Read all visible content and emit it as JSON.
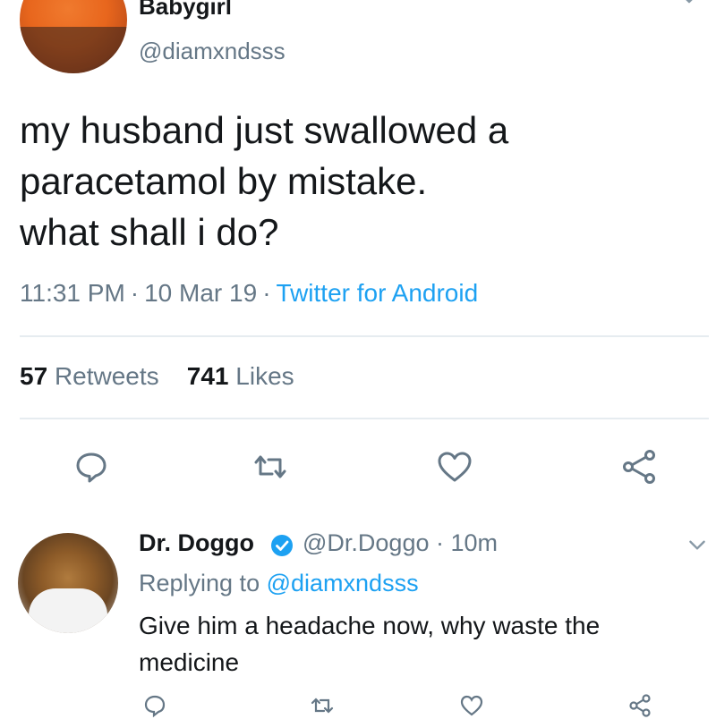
{
  "tweet": {
    "author_name": "Babygirl",
    "author_handle": "@diamxndsss",
    "lines": [
      "my husband just swallowed a",
      "paracetamol by mistake.",
      "what shall i do?"
    ],
    "time": "11:31 PM",
    "date": "10 Mar 19",
    "source": "Twitter for Android",
    "separator": "·",
    "retweets_count": "57",
    "retweets_label": "Retweets",
    "likes_count": "741",
    "likes_label": "Likes"
  },
  "icons": {
    "top_menu": "chevron-down-icon",
    "reply": "reply-bubble-icon",
    "retweet": "retweet-icon",
    "like": "heart-icon",
    "share": "share-icon",
    "verified": "verified-badge-icon"
  },
  "reply": {
    "author_name": "Dr. Doggo",
    "author_handle": "@Dr.Doggo",
    "time_ago": "10m",
    "separator": "·",
    "replying_prefix": "Replying to",
    "replying_to": "@diamxndsss",
    "lines": [
      "Give him a headache now, why waste the",
      "medicine"
    ]
  },
  "colors": {
    "text": "#14171a",
    "secondary": "#657786",
    "link": "#1da1f2",
    "divider": "#e6ecf0",
    "icon": "#657786"
  }
}
